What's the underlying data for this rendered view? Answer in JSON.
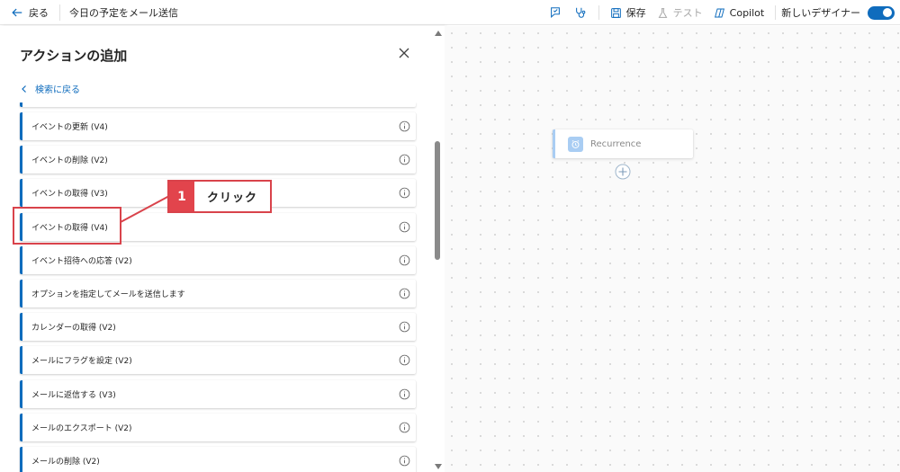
{
  "topbar": {
    "back_label": "戻る",
    "flow_title": "今日の予定をメール送信",
    "save_label": "保存",
    "test_label": "テスト",
    "copilot_label": "Copilot",
    "new_designer_label": "新しいデザイナー",
    "new_designer_on": true
  },
  "panel": {
    "title": "アクションの追加",
    "back_to_search": "検索に戻る",
    "items": [
      {
        "label": ""
      },
      {
        "label": "イベントの更新 (V4)"
      },
      {
        "label": "イベントの削除 (V2)"
      },
      {
        "label": "イベントの取得 (V3)"
      },
      {
        "label": "イベントの取得 (V4)"
      },
      {
        "label": "イベント招待への応答 (V2)"
      },
      {
        "label": "オプションを指定してメールを送信します"
      },
      {
        "label": "カレンダーの取得 (V2)"
      },
      {
        "label": "メールにフラグを設定 (V2)"
      },
      {
        "label": "メールに返信する (V3)"
      },
      {
        "label": "メールのエクスポート (V2)"
      },
      {
        "label": "メールの削除 (V2)"
      }
    ]
  },
  "canvas": {
    "trigger_label": "Recurrence"
  },
  "annotation": {
    "step_number": "1",
    "step_text": "クリック"
  },
  "colors": {
    "accent": "#0f6cbd",
    "trigger_accent": "#a9cdf3",
    "annotation_red": "#e2444c"
  }
}
